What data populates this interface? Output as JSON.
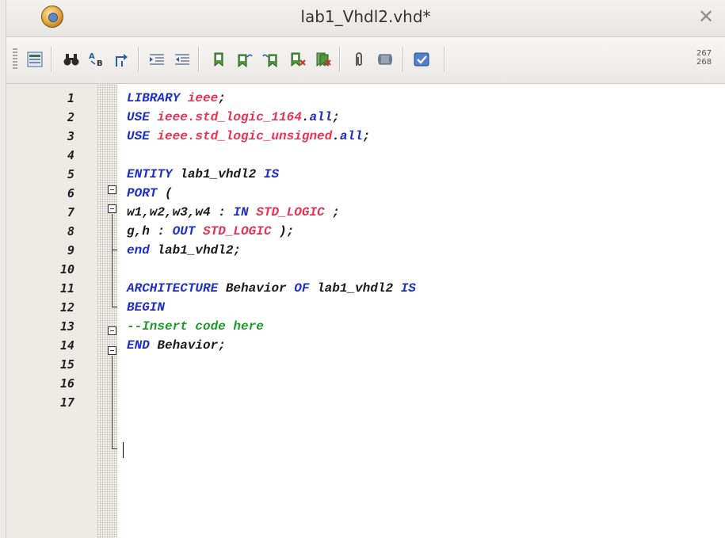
{
  "window": {
    "title": "lab1_Vhdl2.vhd*",
    "app_icon": "active-hdl-app-icon",
    "close_icon": "close-x-icon"
  },
  "toolbar": {
    "buttons": [
      "insert-template-icon",
      "find-icon",
      "replace-icon",
      "goto-icon",
      "indent-icon",
      "outdent-icon",
      "bookmark-icon",
      "next-bookmark-icon",
      "previous-bookmark-icon",
      "delete-bookmark-icon",
      "clear-bookmarks-icon",
      "paperclip-icon",
      "script-icon",
      "check-icon"
    ],
    "line_count_top": "267",
    "line_count_bottom": "268"
  },
  "editor": {
    "line_numbers": [
      "1",
      "2",
      "3",
      "4",
      "5",
      "6",
      "7",
      "8",
      "9",
      "10",
      "11",
      "12",
      "13",
      "14",
      "15",
      "16",
      "17"
    ],
    "lines": [
      [
        {
          "t": "LIBRARY ",
          "c": "kw"
        },
        {
          "t": "ieee",
          "c": "lib"
        },
        {
          "t": ";",
          "c": "id"
        }
      ],
      [
        {
          "t": "USE ",
          "c": "kw"
        },
        {
          "t": "ieee.std_logic_1164",
          "c": "lib"
        },
        {
          "t": ".",
          "c": "id"
        },
        {
          "t": "all",
          "c": "kw"
        },
        {
          "t": ";",
          "c": "id"
        }
      ],
      [
        {
          "t": "USE ",
          "c": "kw"
        },
        {
          "t": "ieee.std_logic_unsigned",
          "c": "lib"
        },
        {
          "t": ".",
          "c": "id"
        },
        {
          "t": "all",
          "c": "kw"
        },
        {
          "t": ";",
          "c": "id"
        }
      ],
      [],
      [
        {
          "t": "ENTITY ",
          "c": "kw"
        },
        {
          "t": "lab1_vhdl2 ",
          "c": "id"
        },
        {
          "t": "IS",
          "c": "kw"
        }
      ],
      [
        {
          "t": "PORT ",
          "c": "kw"
        },
        {
          "t": "(",
          "c": "id"
        }
      ],
      [
        {
          "t": "w1,w2,w3,w4 : ",
          "c": "id"
        },
        {
          "t": "IN ",
          "c": "kw"
        },
        {
          "t": "STD_LOGIC",
          "c": "lib"
        },
        {
          "t": " ;",
          "c": "id"
        }
      ],
      [
        {
          "t": "g,h : ",
          "c": "id"
        },
        {
          "t": "OUT ",
          "c": "kw"
        },
        {
          "t": "STD_LOGIC",
          "c": "lib"
        },
        {
          "t": " );",
          "c": "id"
        }
      ],
      [
        {
          "t": "end ",
          "c": "kw"
        },
        {
          "t": "lab1_vhdl2;",
          "c": "id"
        }
      ],
      [],
      [
        {
          "t": "ARCHITECTURE ",
          "c": "kw"
        },
        {
          "t": "Behavior ",
          "c": "id"
        },
        {
          "t": "OF ",
          "c": "kw"
        },
        {
          "t": "lab1_vhdl2 ",
          "c": "id"
        },
        {
          "t": "IS",
          "c": "kw"
        }
      ],
      [
        {
          "t": "BEGIN",
          "c": "kw"
        }
      ],
      [
        {
          "t": "--Insert code here",
          "c": "cm"
        }
      ],
      [
        {
          "t": "END ",
          "c": "kw"
        },
        {
          "t": "Behavior;",
          "c": "id"
        }
      ],
      [],
      [],
      []
    ]
  },
  "colors": {
    "keyword": "#1e2ec8",
    "library": "#e83355",
    "identifier": "#1a1a1a",
    "comment": "#1e9a2b",
    "gutter": "#eeebe5"
  }
}
